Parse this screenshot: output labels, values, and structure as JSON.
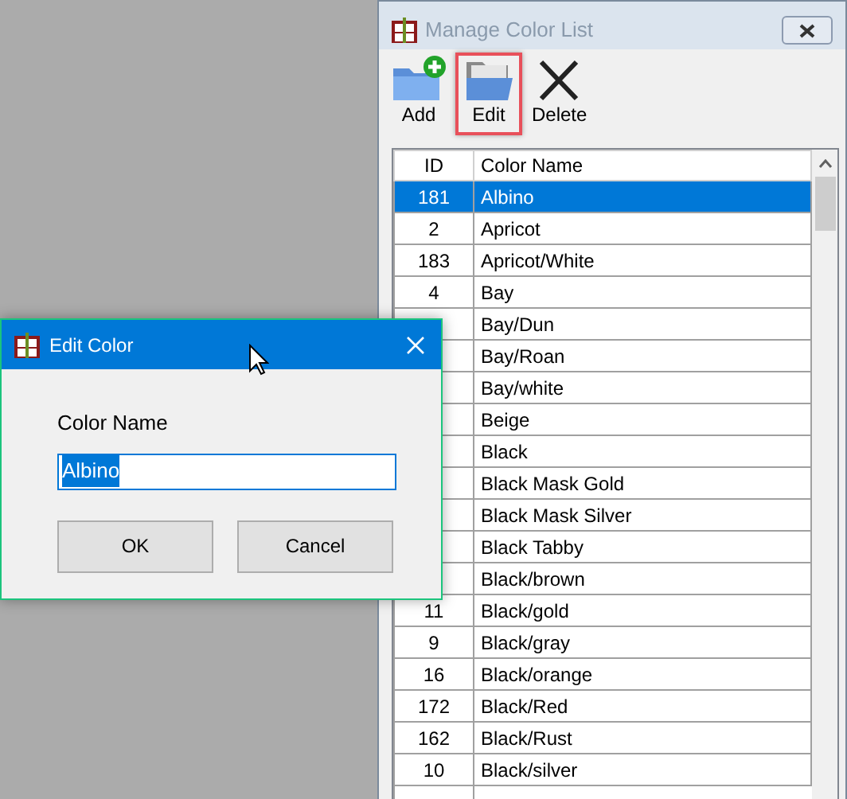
{
  "main_window": {
    "title": "Manage Color List",
    "active": false,
    "toolbar": [
      {
        "label": "Add",
        "kind": "add",
        "highlighted": false
      },
      {
        "label": "Edit",
        "kind": "edit",
        "highlighted": true
      },
      {
        "label": "Delete",
        "kind": "delete",
        "highlighted": false
      }
    ],
    "table": {
      "columns": [
        "ID",
        "Color Name"
      ],
      "rows": [
        {
          "id": "181",
          "name": "Albino",
          "selected": true
        },
        {
          "id": "2",
          "name": "Apricot",
          "selected": false
        },
        {
          "id": "183",
          "name": "Apricot/White",
          "selected": false
        },
        {
          "id": "4",
          "name": "Bay",
          "selected": false
        },
        {
          "name": "Bay/Dun",
          "selected": false
        },
        {
          "name": "Bay/Roan",
          "selected": false
        },
        {
          "name": "Bay/white",
          "selected": false
        },
        {
          "name": "Beige",
          "selected": false
        },
        {
          "name": "Black",
          "selected": false
        },
        {
          "name": "Black Mask Gold",
          "selected": false
        },
        {
          "name": "Black Mask Silver",
          "selected": false
        },
        {
          "name": "Black Tabby",
          "selected": false
        },
        {
          "name": "Black/brown",
          "selected": false
        },
        {
          "id": "11",
          "name": "Black/gold",
          "selected": false
        },
        {
          "id": "9",
          "name": "Black/gray",
          "selected": false
        },
        {
          "id": "16",
          "name": "Black/orange",
          "selected": false
        },
        {
          "id": "172",
          "name": "Black/Red",
          "selected": false
        },
        {
          "id": "162",
          "name": "Black/Rust",
          "selected": false
        },
        {
          "id": "10",
          "name": "Black/silver",
          "selected": false
        }
      ]
    }
  },
  "dialog": {
    "title": "Edit Color",
    "label": "Color Name",
    "value": "Albino",
    "value_selected": true,
    "buttons": [
      "OK",
      "Cancel"
    ]
  }
}
